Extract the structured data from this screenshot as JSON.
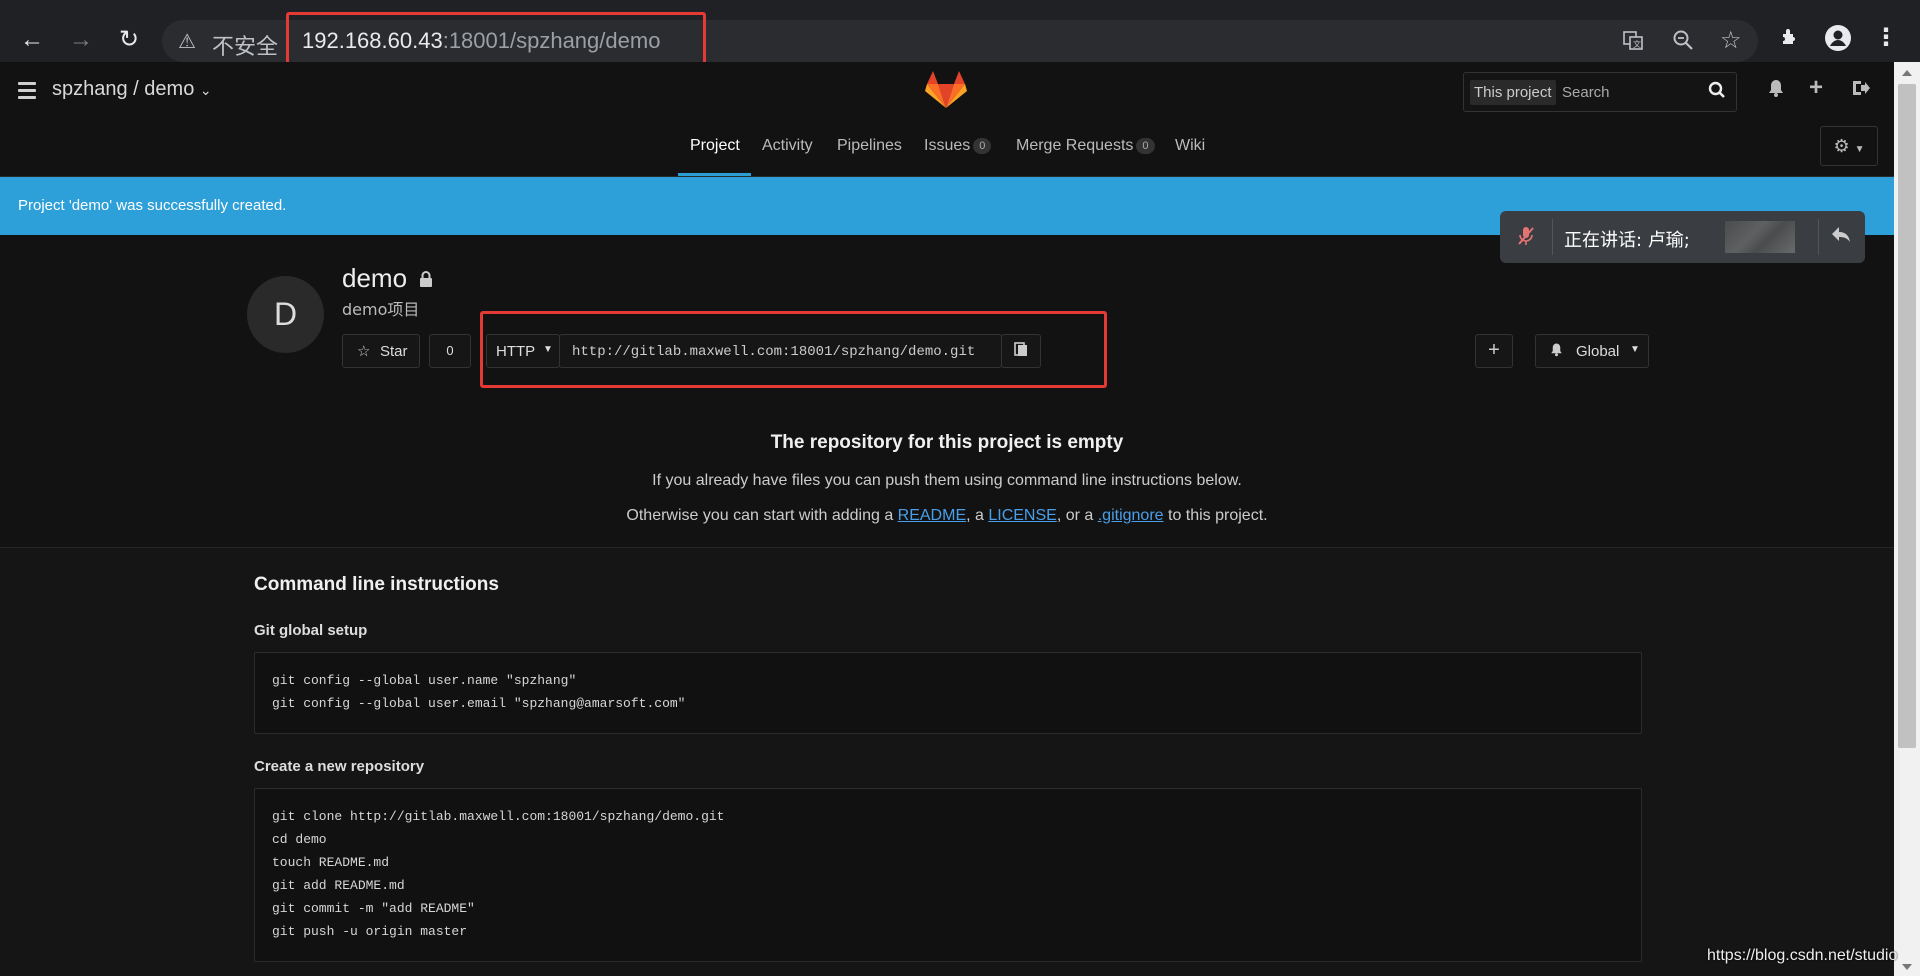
{
  "browser": {
    "insecure_label": "不安全",
    "url_host": "192.168.60.43",
    "url_path": ":18001/spzhang/demo",
    "back_icon": "←",
    "forward_icon": "→",
    "reload_icon": "↻"
  },
  "header": {
    "project_path": "spzhang / demo",
    "search_scope": "This project",
    "search_placeholder": "Search"
  },
  "nav": {
    "tabs": [
      {
        "label": "Project"
      },
      {
        "label": "Activity"
      },
      {
        "label": "Pipelines"
      },
      {
        "label": "Issues",
        "count": "0"
      },
      {
        "label": "Merge Requests",
        "count": "0"
      },
      {
        "label": "Wiki"
      }
    ]
  },
  "flash": {
    "message": "Project 'demo' was successfully created."
  },
  "speaking_popup": {
    "text": "正在讲话: 卢瑜;"
  },
  "project": {
    "avatar_letter": "D",
    "name": "demo",
    "description": "demo项目",
    "star_label": "Star",
    "star_count": "0",
    "protocol": "HTTP",
    "clone_url": "http://gitlab.maxwell.com:18001/spzhang/demo.git",
    "notification_label": "Global"
  },
  "empty_repo": {
    "title": "The repository for this project is empty",
    "line1": "If you already have files you can push them using command line instructions below.",
    "line2_prefix": "Otherwise you can start with adding a ",
    "readme_link": "README",
    "sep1": ", a ",
    "license_link": "LICENSE",
    "sep2": ", or a ",
    "gitignore_link": ".gitignore",
    "line2_suffix": " to this project."
  },
  "cli": {
    "title": "Command line instructions",
    "global_setup_title": "Git global setup",
    "global_setup_lines": [
      "git config --global user.name \"spzhang\"",
      "git config --global user.email \"spzhang@amarsoft.com\""
    ],
    "new_repo_title": "Create a new repository",
    "new_repo_lines": [
      "git clone http://gitlab.maxwell.com:18001/spzhang/demo.git",
      "cd demo",
      "touch README.md",
      "git add README.md",
      "git commit -m \"add README\"",
      "git push -u origin master"
    ]
  },
  "watermark": "https://blog.csdn.net/studio",
  "colors": {
    "accent": "#2d9fd9",
    "highlight_box": "#e53935",
    "link": "#4a9fe8"
  }
}
